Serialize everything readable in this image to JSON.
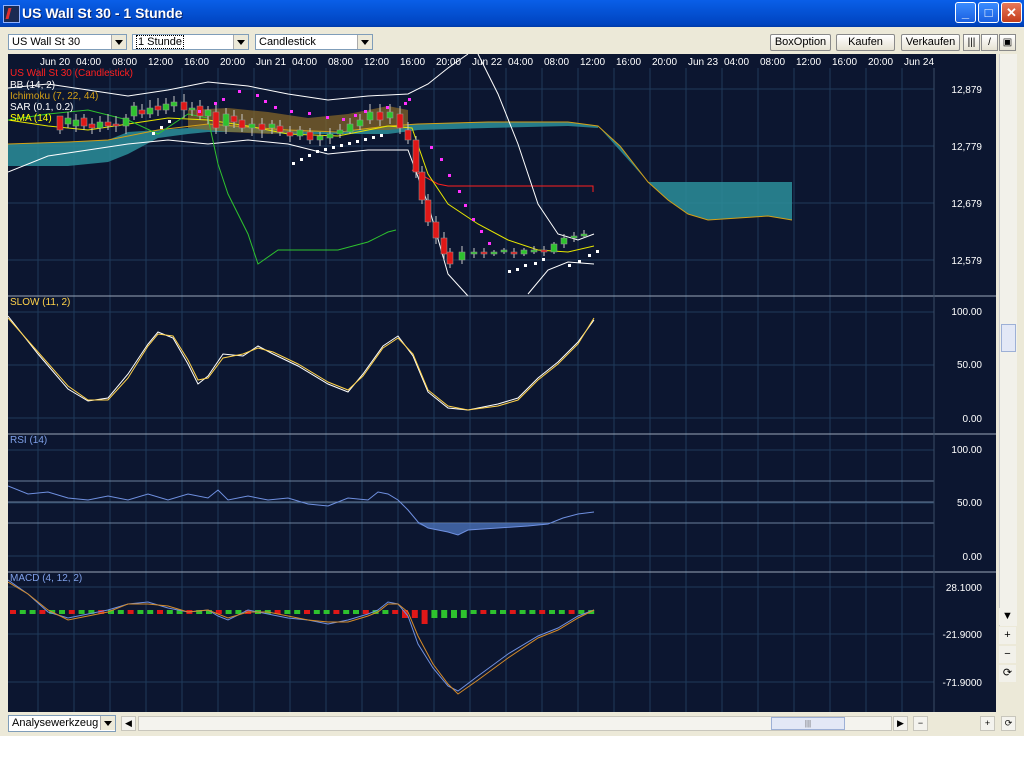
{
  "window": {
    "title": "US Wall St 30 - 1 Stunde",
    "min": "_",
    "max": "□",
    "close": "✕"
  },
  "toolbar": {
    "instrument": "US Wall St 30",
    "timeframe": "1 Stunde",
    "chart_type": "Candlestick",
    "buttons": {
      "boxoption": "BoxOption",
      "kaufen": "Kaufen",
      "verkaufen": "Verkaufen"
    },
    "tool_icons": [
      "bars-icon",
      "pen-icon",
      "window-icon"
    ]
  },
  "time_axis": {
    "labels": [
      "Jun 20",
      "04:00",
      "08:00",
      "12:00",
      "16:00",
      "20:00",
      "Jun 21",
      "04:00",
      "08:00",
      "12:00",
      "16:00",
      "20:00",
      "Jun 22",
      "04:00",
      "08:00",
      "12:00",
      "16:00",
      "20:00",
      "Jun 23",
      "04:00",
      "08:00",
      "12:00",
      "16:00",
      "20:00",
      "Jun 24"
    ]
  },
  "panels": {
    "price": {
      "legend": [
        "US Wall St 30 (Candlestick)",
        "BB (14, 2)",
        "Ichimoku (7, 22, 44)",
        "SAR (0.1, 0.2)",
        "SMA (14)"
      ],
      "legend_colors": [
        "#ff2020",
        "#ffffff",
        "#d4a017",
        "#ffffff",
        "#ffff00"
      ],
      "ticks": [
        "12,879",
        "12,779",
        "12,679",
        "12,579"
      ]
    },
    "slow": {
      "legend": "SLOW (11, 2)",
      "legend_color": "#ffd24a",
      "ticks": [
        "100.00",
        "50.00",
        "0.00"
      ]
    },
    "rsi": {
      "legend": "RSI (14)",
      "legend_color": "#7fa0e8",
      "ticks": [
        "100.00",
        "50.00",
        "0.00"
      ]
    },
    "macd": {
      "legend": "MACD (4, 12, 2)",
      "legend_color": "#7fa0e8",
      "ticks": [
        "28.1000",
        "-21.9000",
        "-71.9000"
      ]
    }
  },
  "sidebar": {
    "scroll_down": "▼",
    "zoom_in": "+",
    "zoom_out": "−",
    "reset": "⟳"
  },
  "bottom": {
    "tool_select": "Analysewerkzeug",
    "scroll_left": "◀",
    "scroll_right": "▶",
    "thumb_grip": "|||",
    "minus": "−",
    "plus": "+",
    "refresh": "⟳"
  },
  "colors": {
    "background": "#0c1630",
    "grid": "#1f3a5a",
    "up": "#2ec22e",
    "down": "#e01818",
    "cloud": "#2b8e9a"
  }
}
